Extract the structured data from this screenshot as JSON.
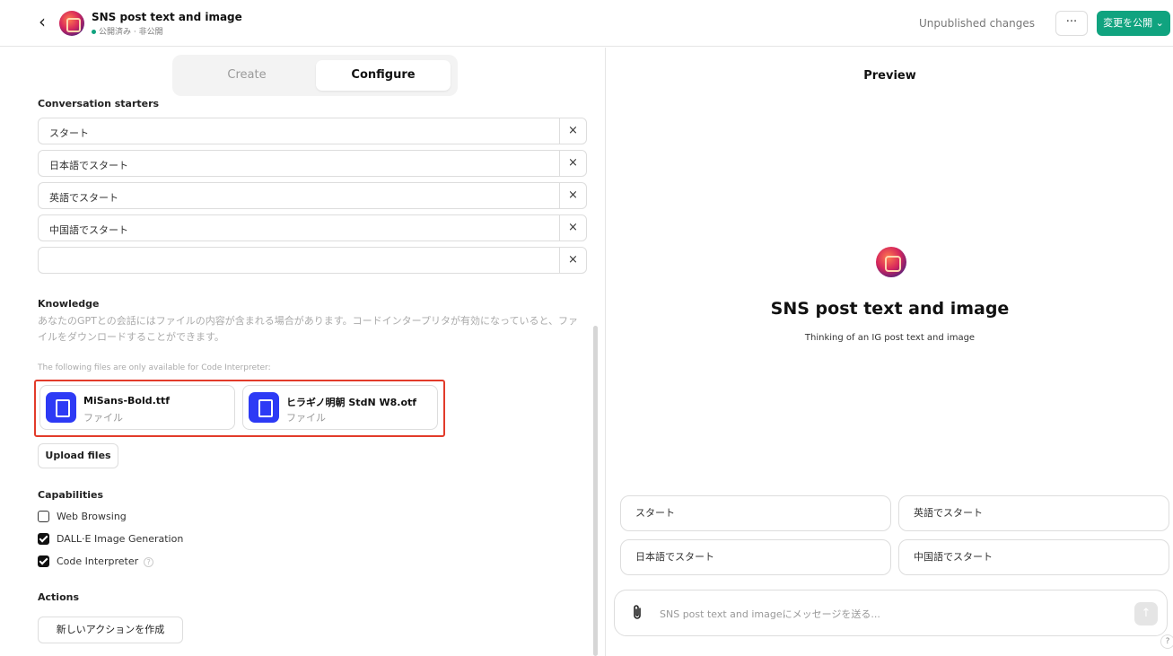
{
  "header": {
    "back_icon": "chevron-left-icon",
    "title": "SNS post text and image",
    "status": "公開済み · 非公開",
    "unpublished": "Unpublished changes",
    "more_label": "···",
    "publish_label": "変更を公開 ⌄"
  },
  "tabs": {
    "create": "Create",
    "configure": "Configure"
  },
  "starters": {
    "label": "Conversation starters",
    "items": [
      "スタート",
      "日本語でスタート",
      "英語でスタート",
      "中国語でスタート",
      ""
    ],
    "remove_glyph": "×"
  },
  "knowledge": {
    "label": "Knowledge",
    "description": "あなたのGPTとの会話にはファイルの内容が含まれる場合があります。コードインタープリタが有効になっていると、ファイルをダウンロードすることができます。",
    "note": "The following files are only available for Code Interpreter:",
    "files": [
      {
        "name": "MiSans-Bold.ttf",
        "type": "ファイル"
      },
      {
        "name": "ヒラギノ明朝 StdN W8.otf",
        "type": "ファイル"
      }
    ],
    "upload_label": "Upload files",
    "highlight_color": "#e23b2a"
  },
  "capabilities": {
    "label": "Capabilities",
    "items": [
      {
        "label": "Web Browsing",
        "checked": false
      },
      {
        "label": "DALL·E Image Generation",
        "checked": true
      },
      {
        "label": "Code Interpreter",
        "checked": true
      }
    ],
    "help_glyph": "?"
  },
  "actions": {
    "label": "Actions",
    "create_label": "新しいアクションを作成"
  },
  "preview": {
    "title": "Preview",
    "gpt_name": "SNS post text and image",
    "gpt_description": "Thinking of an IG post text and image",
    "starters": [
      "スタート",
      "英語でスタート",
      "日本語でスタート",
      "中国語でスタート"
    ],
    "message_placeholder": "SNS post text and imageにメッセージを送る...",
    "send_glyph": "↑",
    "help_glyph": "?"
  },
  "colors": {
    "accent": "#10a37f",
    "file_icon": "#2d3af5"
  }
}
